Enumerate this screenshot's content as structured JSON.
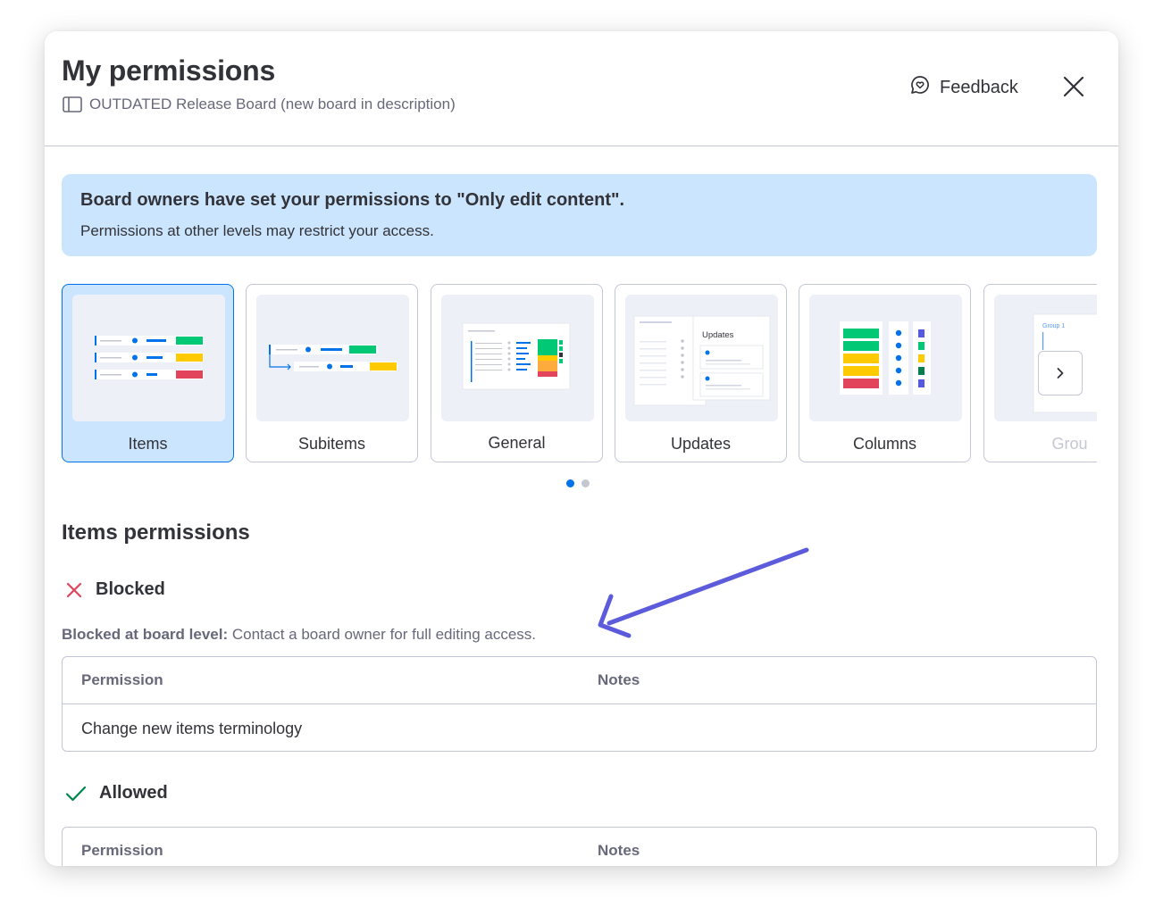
{
  "header": {
    "title": "My permissions",
    "board_name": "OUTDATED Release Board (new board in description)",
    "feedback_label": "Feedback"
  },
  "banner": {
    "title": "Board owners have set your permissions to \"Only edit content\".",
    "text": "Permissions at other levels may restrict your access."
  },
  "carousel": {
    "cards": [
      {
        "label": "Items",
        "selected": true
      },
      {
        "label": "Subitems"
      },
      {
        "label": "General"
      },
      {
        "label": "Updates",
        "thumb_text": "Updates"
      },
      {
        "label": "Columns"
      },
      {
        "label": "Grou",
        "thumb_text": "Group 1"
      }
    ],
    "page": 1,
    "page_count": 2
  },
  "section": {
    "title": "Items permissions",
    "blocked": {
      "label": "Blocked",
      "note_bold": "Blocked at board level:",
      "note_text": " Contact a board owner for full editing access.",
      "columns": [
        "Permission",
        "Notes"
      ],
      "rows": [
        {
          "permission": "Change new items terminology",
          "notes": ""
        }
      ]
    },
    "allowed": {
      "label": "Allowed",
      "columns": [
        "Permission",
        "Notes"
      ]
    }
  },
  "colors": {
    "accent": "#0073ea",
    "banner_bg": "#cce5ff",
    "blocked": "#e2445c",
    "allowed": "#00854d",
    "annotation_arrow": "#5b5bdc",
    "green": "#00c875",
    "yellow": "#ffcb00",
    "red": "#e2445c",
    "orange": "#fdab3d"
  }
}
